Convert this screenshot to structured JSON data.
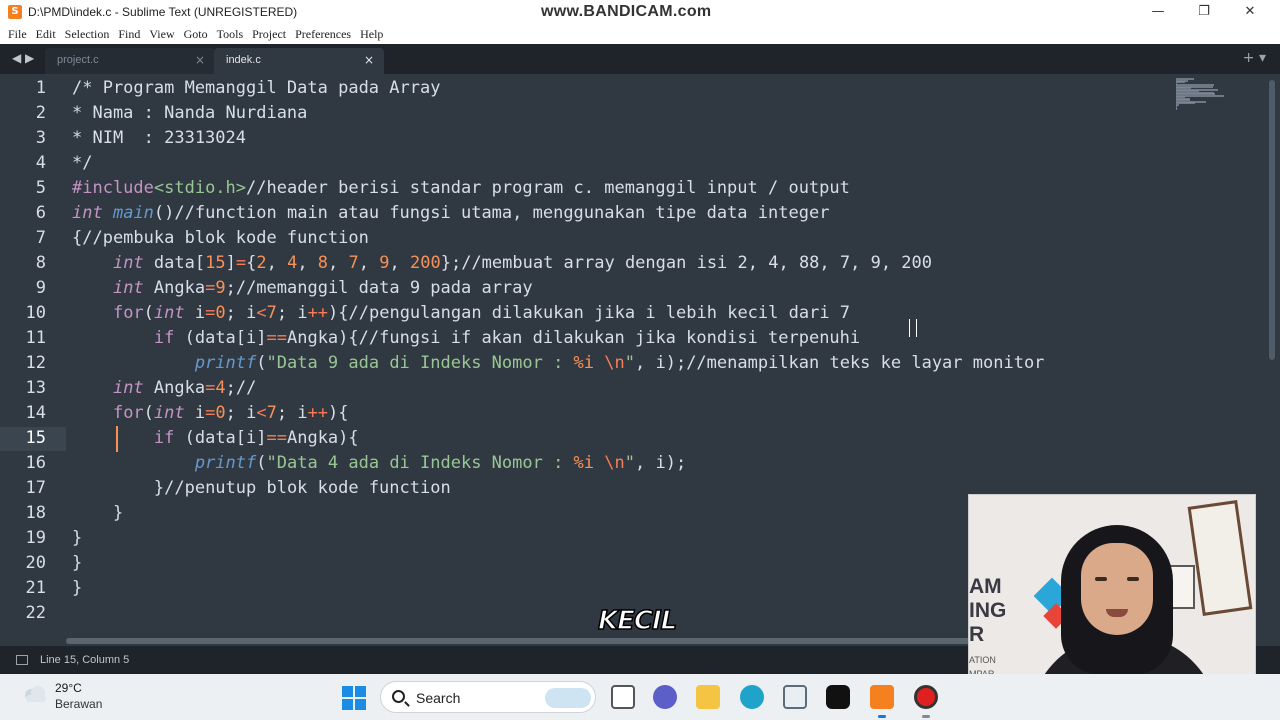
{
  "window": {
    "title": "D:\\PMD\\indek.c - Sublime Text (UNREGISTERED)",
    "watermark": "www.BANDICAM.com",
    "minimize": "—",
    "maximize": "❐",
    "close": "✕"
  },
  "menu": [
    "File",
    "Edit",
    "Selection",
    "Find",
    "View",
    "Goto",
    "Tools",
    "Project",
    "Preferences",
    "Help"
  ],
  "tabs": [
    {
      "label": "project.c",
      "close": "×",
      "active": false
    },
    {
      "label": "indek.c",
      "close": "×",
      "active": true
    }
  ],
  "tab_nav": "◀ ▶",
  "tab_tools": "+ ▾",
  "editor": {
    "current_line": 15,
    "line_numbers": [
      "1",
      "2",
      "3",
      "4",
      "5",
      "6",
      "7",
      "8",
      "9",
      "10",
      "11",
      "12",
      "13",
      "14",
      "15",
      "16",
      "17",
      "18",
      "19",
      "20",
      "21",
      "22"
    ],
    "lines": [
      [
        {
          "t": "/* Program Memanggil Data pada Array",
          "c": "cm"
        }
      ],
      [
        {
          "t": "* Nama : Nanda Nurdiana",
          "c": "cm"
        }
      ],
      [
        {
          "t": "* NIM  : 23313024",
          "c": "cm"
        }
      ],
      [
        {
          "t": "*/",
          "c": "cm"
        }
      ],
      [
        {
          "t": "#include",
          "c": "pp"
        },
        {
          "t": "<stdio.h>",
          "c": "hdr"
        },
        {
          "t": "//header berisi standar program c. memanggil input / output",
          "c": "cm"
        }
      ],
      [
        {
          "t": "int",
          "c": "ty"
        },
        {
          "t": " ",
          "c": ""
        },
        {
          "t": "main",
          "c": "fn"
        },
        {
          "t": "()//function main atau fungsi utama, menggunakan tipe data integer",
          "c": "cm"
        }
      ],
      [
        {
          "t": "{//pembuka blok kode function",
          "c": "cm"
        }
      ],
      [
        {
          "t": "    ",
          "c": ""
        },
        {
          "t": "int",
          "c": "ty"
        },
        {
          "t": " data[",
          "c": ""
        },
        {
          "t": "15",
          "c": "num"
        },
        {
          "t": "]",
          "c": ""
        },
        {
          "t": "=",
          "c": "op"
        },
        {
          "t": "{",
          "c": ""
        },
        {
          "t": "2",
          "c": "num"
        },
        {
          "t": ", ",
          "c": ""
        },
        {
          "t": "4",
          "c": "num"
        },
        {
          "t": ", ",
          "c": ""
        },
        {
          "t": "8",
          "c": "num"
        },
        {
          "t": ", ",
          "c": ""
        },
        {
          "t": "7",
          "c": "num"
        },
        {
          "t": ", ",
          "c": ""
        },
        {
          "t": "9",
          "c": "num"
        },
        {
          "t": ", ",
          "c": ""
        },
        {
          "t": "200",
          "c": "num"
        },
        {
          "t": "};//membuat array dengan isi 2, 4, 88, 7, 9, 200",
          "c": "cm"
        }
      ],
      [
        {
          "t": "    ",
          "c": ""
        },
        {
          "t": "int",
          "c": "ty"
        },
        {
          "t": " Angka",
          "c": ""
        },
        {
          "t": "=",
          "c": "op"
        },
        {
          "t": "9",
          "c": "num"
        },
        {
          "t": ";//memanggil data 9 pada array",
          "c": "cm"
        }
      ],
      [
        {
          "t": "    ",
          "c": ""
        },
        {
          "t": "for",
          "c": "kw"
        },
        {
          "t": "(",
          "c": ""
        },
        {
          "t": "int",
          "c": "ty"
        },
        {
          "t": " i",
          "c": ""
        },
        {
          "t": "=",
          "c": "op"
        },
        {
          "t": "0",
          "c": "num"
        },
        {
          "t": "; i",
          "c": ""
        },
        {
          "t": "<",
          "c": "op"
        },
        {
          "t": "7",
          "c": "num"
        },
        {
          "t": "; i",
          "c": ""
        },
        {
          "t": "++",
          "c": "op"
        },
        {
          "t": "){//pengulangan dilakukan jika i lebih kecil dari 7",
          "c": "cm"
        }
      ],
      [
        {
          "t": "        ",
          "c": ""
        },
        {
          "t": "if",
          "c": "kw"
        },
        {
          "t": " (data[i]",
          "c": ""
        },
        {
          "t": "==",
          "c": "op"
        },
        {
          "t": "Angka){//fungsi if akan dilakukan jika kondisi terpenuhi",
          "c": "cm"
        }
      ],
      [
        {
          "t": "            ",
          "c": ""
        },
        {
          "t": "printf",
          "c": "fn"
        },
        {
          "t": "(",
          "c": ""
        },
        {
          "t": "\"Data 9 ada di Indeks Nomor : ",
          "c": "str"
        },
        {
          "t": "%i",
          "c": "num"
        },
        {
          "t": " ",
          "c": "str"
        },
        {
          "t": "\\n",
          "c": "op"
        },
        {
          "t": "\"",
          "c": "str"
        },
        {
          "t": ", i);//menampilkan teks ke layar monitor",
          "c": "cm"
        }
      ],
      [
        {
          "t": "    ",
          "c": ""
        },
        {
          "t": "int",
          "c": "ty"
        },
        {
          "t": " Angka",
          "c": ""
        },
        {
          "t": "=",
          "c": "op"
        },
        {
          "t": "4",
          "c": "num"
        },
        {
          "t": ";//",
          "c": "cm"
        }
      ],
      [
        {
          "t": "    ",
          "c": ""
        },
        {
          "t": "for",
          "c": "kw"
        },
        {
          "t": "(",
          "c": ""
        },
        {
          "t": "int",
          "c": "ty"
        },
        {
          "t": " i",
          "c": ""
        },
        {
          "t": "=",
          "c": "op"
        },
        {
          "t": "0",
          "c": "num"
        },
        {
          "t": "; i",
          "c": ""
        },
        {
          "t": "<",
          "c": "op"
        },
        {
          "t": "7",
          "c": "num"
        },
        {
          "t": "; i",
          "c": ""
        },
        {
          "t": "++",
          "c": "op"
        },
        {
          "t": "){",
          "c": ""
        }
      ],
      [
        {
          "t": "        ",
          "c": ""
        },
        {
          "t": "if",
          "c": "kw"
        },
        {
          "t": " (data[i]",
          "c": ""
        },
        {
          "t": "==",
          "c": "op"
        },
        {
          "t": "Angka){",
          "c": ""
        }
      ],
      [
        {
          "t": "            ",
          "c": ""
        },
        {
          "t": "printf",
          "c": "fn"
        },
        {
          "t": "(",
          "c": ""
        },
        {
          "t": "\"Data 4 ada di Indeks Nomor : ",
          "c": "str"
        },
        {
          "t": "%i",
          "c": "num"
        },
        {
          "t": " ",
          "c": "str"
        },
        {
          "t": "\\n",
          "c": "op"
        },
        {
          "t": "\"",
          "c": "str"
        },
        {
          "t": ", i);",
          "c": ""
        }
      ],
      [
        {
          "t": "        ",
          "c": ""
        },
        {
          "t": "}//penutup blok kode function",
          "c": "cm"
        }
      ],
      [
        {
          "t": "    }",
          "c": ""
        }
      ],
      [
        {
          "t": "}",
          "c": ""
        }
      ],
      [
        {
          "t": "}",
          "c": ""
        }
      ],
      [
        {
          "t": "}",
          "c": ""
        }
      ],
      [
        {
          "t": "",
          "c": ""
        }
      ]
    ]
  },
  "status": {
    "position": "Line 15, Column 5"
  },
  "caption": "KECIL",
  "webcam": {
    "wall_logo": "AM\nING\nR",
    "wall_small": "ATION\nMPAR"
  },
  "taskbar": {
    "temperature": "29°C",
    "condition": "Berawan",
    "search_label": "Search",
    "apps": [
      "task-view-icon",
      "chat-icon",
      "file-explorer-icon",
      "edge-browser-icon",
      "store-icon",
      "tiktok-icon",
      "sublime-text-icon",
      "bandicam-record-icon"
    ]
  },
  "colors": {
    "editor_bg": "#303841",
    "keyword": "#c594c5",
    "function": "#6699cc",
    "number": "#f99157",
    "string": "#99c794",
    "cursor": "#f99157"
  }
}
